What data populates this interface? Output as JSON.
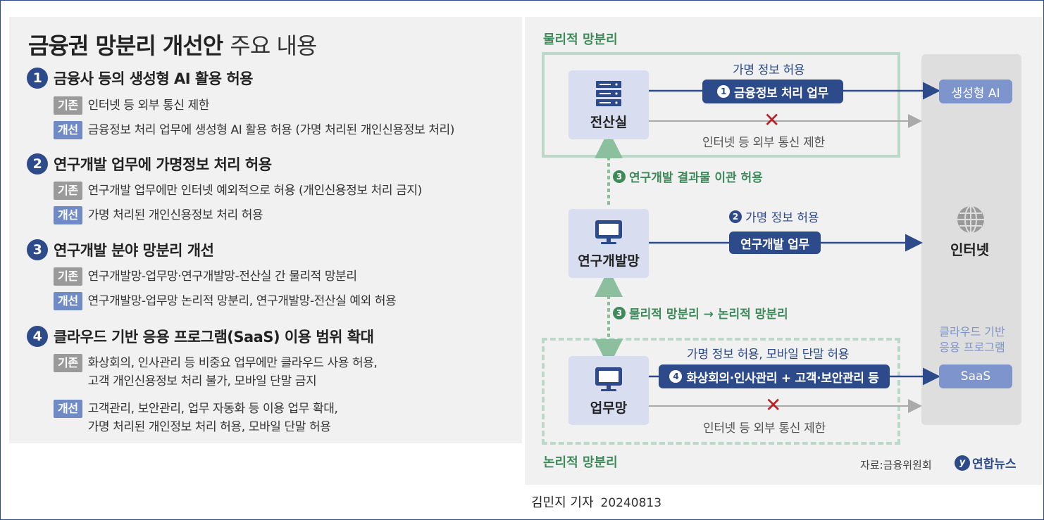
{
  "title": {
    "bold": "금융권 망분리 개선안",
    "light": "주요 내용"
  },
  "sections": [
    {
      "num": "1",
      "heading": "금융사 등의 생성형 AI 활용 허용",
      "base_tag": "기존",
      "base_text": "인터넷 등 외부 통신 제한",
      "new_tag": "개선",
      "new_text": "금융정보 처리 업무에 생성형 AI 활용 허용 (가명 처리된 개인신용정보 처리)"
    },
    {
      "num": "2",
      "heading": "연구개발 업무에 가명정보 처리 허용",
      "base_tag": "기존",
      "base_text": "연구개발 업무에만 인터넷 예외적으로 허용 (개인신용정보 처리 금지)",
      "new_tag": "개선",
      "new_text": "가명 처리된 개인신용정보 처리 허용"
    },
    {
      "num": "3",
      "heading": "연구개발 분야 망분리 개선",
      "base_tag": "기존",
      "base_text": "연구개발망-업무망·연구개발망-전산실 간 물리적 망분리",
      "new_tag": "개선",
      "new_text": "연구개발망-업무망 논리적 망분리, 연구개발망-전산실 예외 허용"
    },
    {
      "num": "4",
      "heading": "클라우드 기반 응용 프로그램(SaaS) 이용 범위 확대",
      "base_tag": "기존",
      "base_text": "화상회의, 인사관리 등 비중요 업무에만 클라우드 사용 허용,\n고객 개인신용정보 처리 불가, 모바일 단말 금지",
      "new_tag": "개선",
      "new_text": "고객관리, 보안관리, 업무 자동화 등 이용 업무 확대,\n가명 처리된 개인정보 처리 허용, 모바일 단말 허용"
    }
  ],
  "diagram": {
    "physical_label": "물리적 망분리",
    "logical_label": "논리적 망분리",
    "nodes": {
      "server": "전산실",
      "rnd": "연구개발망",
      "work": "업무망",
      "internet": "인터넷"
    },
    "server_flow": {
      "top_text": "가명 정보 허용",
      "num": "1",
      "pill": "금융정보 처리 업무",
      "blocked": "인터넷 등 외부 통신 제한"
    },
    "rnd_flow": {
      "num": "2",
      "top_text": "가명 정보 허용",
      "pill": "연구개발 업무"
    },
    "link_top": {
      "num": "3",
      "text": "연구개발 결과물 이관 허용"
    },
    "link_bottom": {
      "num": "3",
      "text": "물리적 망분리 → 논리적 망분리"
    },
    "work_flow": {
      "top_text": "가명 정보 허용, 모바일 단말 허용",
      "num": "4",
      "pill": "화상회의·인사관리 + 고객·보안관리 등",
      "blocked": "인터넷 등 외부 통신 제한"
    },
    "targets": {
      "ai": "생성형 AI",
      "cloud_label": "클라우드 기반\n응용 프로그램",
      "saas": "SaaS"
    }
  },
  "source": "자료:금융위원회",
  "logo": "연합뉴스",
  "byline": {
    "author": "김민지 기자",
    "date": "20240813"
  },
  "colors": {
    "navy": "#2d4a8a",
    "green": "#3e8a5a",
    "light_blue": "#7d94cc",
    "red": "#b8232a"
  }
}
